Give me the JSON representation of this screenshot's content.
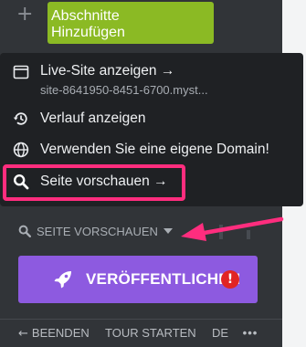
{
  "top": {
    "add_sections_label": "Abschnitte\nHinzufügen"
  },
  "menu": {
    "items": [
      {
        "label": "Live-Site anzeigen →",
        "sub": "site-8641950-8451-6700.myst...",
        "icon": "window-icon"
      },
      {
        "label": "Verlauf anzeigen",
        "icon": "history-icon"
      },
      {
        "label": "Verwenden Sie eine eigene Domain!",
        "icon": "globe-icon"
      },
      {
        "label": "Seite vorschauen →",
        "icon": "search-icon"
      }
    ]
  },
  "preview_link": {
    "label": "SEITE VORSCHAUEN"
  },
  "publish": {
    "label": "VERÖFFENTLICHEN",
    "alert": "!"
  },
  "footer": {
    "exit_label": "BEENDEN",
    "tour_label": "TOUR STARTEN",
    "lang_label": "DE",
    "more": "•••"
  },
  "colors": {
    "accent_green": "#8bba24",
    "publish_purple": "#8d5ae0",
    "annotation_pink": "#ff2d7e",
    "alert_red": "#e12424"
  }
}
